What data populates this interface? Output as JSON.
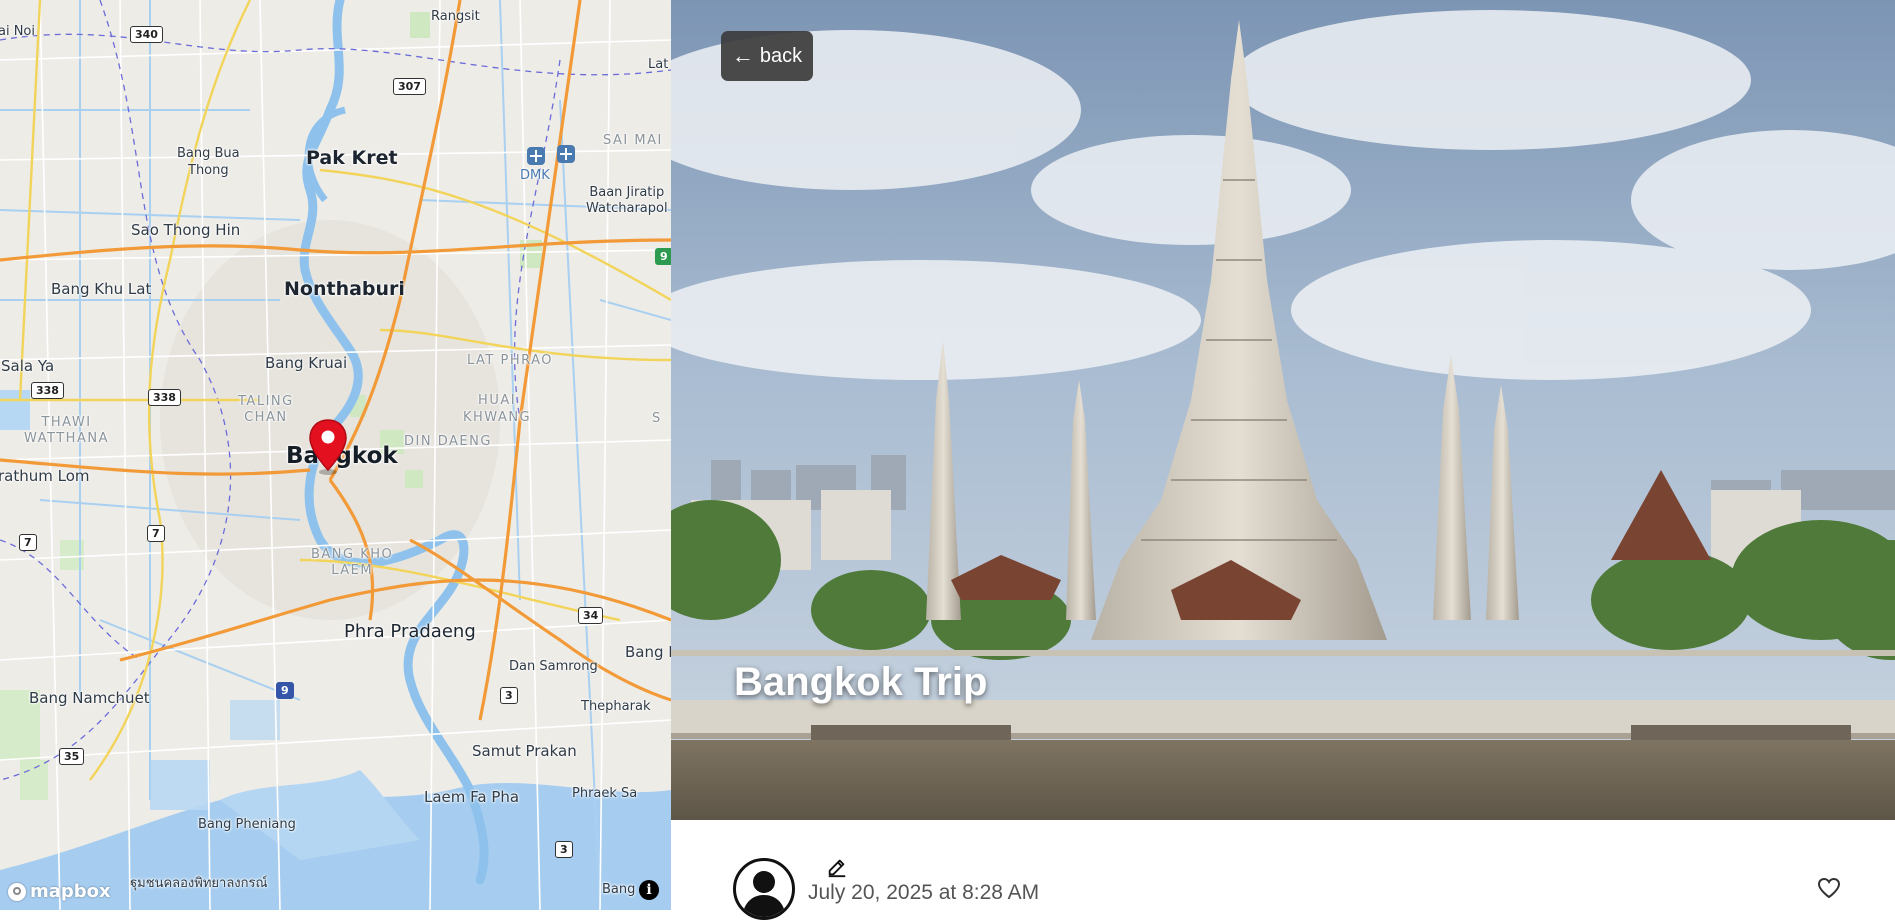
{
  "map": {
    "places": {
      "rangsit": "Rangsit",
      "sai_noi": "ai Noi",
      "lat": "Lat",
      "bang_bua_thong": "Bang Bua\nThong",
      "pak_kret": "Pak Kret",
      "sai_mai": "SAI MAI",
      "dmk": "DMK",
      "baan_jiratip": "Baan Jiratip\nWatcharapol",
      "sao_thong_hin": "Sao Thong Hin",
      "bang_khu_lat": "Bang Khu Lat",
      "nonthaburi": "Nonthaburi",
      "sala_ya": "Sala Ya",
      "bang_kruai": "Bang Kruai",
      "lat_phrao": "LAT PHRAO",
      "taling_chan": "TALING\nCHAN",
      "thawi_watthana": "THAWI\nWATTHANA",
      "huai_khwang": "HUAI\nKHWANG",
      "s": "S",
      "din_daeng": "DIN DAENG",
      "bangkok": "Bangkok",
      "rathum_lom": "rathum Lom",
      "bang_kho_laem": "BANG KHO\nLAEM",
      "phra_pradaeng": "Phra Pradaeng",
      "bang_k": "Bang K",
      "dan_samrong": "Dan Samrong",
      "bang_namchuet": "Bang Namchuet",
      "thepharak": "Thepharak",
      "samut_prakan": "Samut Prakan",
      "laem_fa_pha": "Laem Fa Pha",
      "phraek_sa": "Phraek Sa",
      "bang_pheniang": "Bang Pheniang",
      "thai_canal": "ฐุมชนคลองพิทยาลงกรณ์",
      "bang_bottom": "Bang"
    },
    "shields": {
      "r340": "340",
      "r307": "307",
      "r9_right": "9",
      "r338_left": "338",
      "r338": "338",
      "r7_left": "7",
      "r7": "7",
      "r34": "34",
      "r9": "9",
      "r3": "3",
      "r35": "35",
      "r3_bottom": "3"
    },
    "pin_icon": "map-marker",
    "attribution_logo": "mapbox",
    "info_icon": "i"
  },
  "hero": {
    "back_label": "back",
    "back_icon": "left-arrow",
    "title": "Bangkok Trip"
  },
  "post": {
    "date": "July 20, 2025 at 8:28 AM",
    "avatar_icon": "user-avatar",
    "edit_icon": "edit",
    "like_icon": "heart"
  }
}
